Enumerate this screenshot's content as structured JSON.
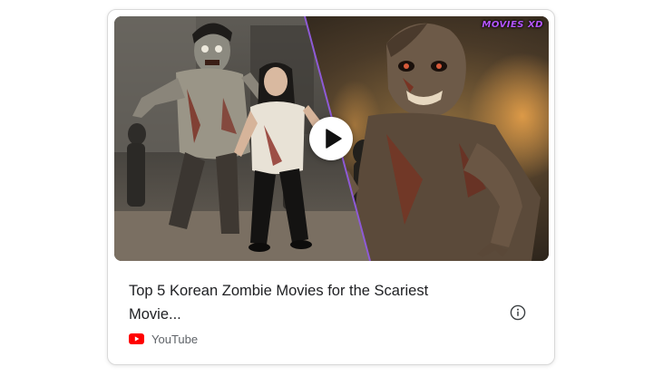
{
  "video": {
    "title_line1": "Top 5 Korean Zombie Movies for the Scariest",
    "title_line2": "Movie...",
    "source": "YouTube",
    "watermark": "MOVIES XD"
  },
  "icons": {
    "play": "play-icon",
    "info": "info-icon",
    "source": "youtube-icon"
  },
  "colors": {
    "youtube_red": "#ff0000",
    "watermark": "#b455ff",
    "title_text": "#202124",
    "source_text": "#5f6368"
  }
}
